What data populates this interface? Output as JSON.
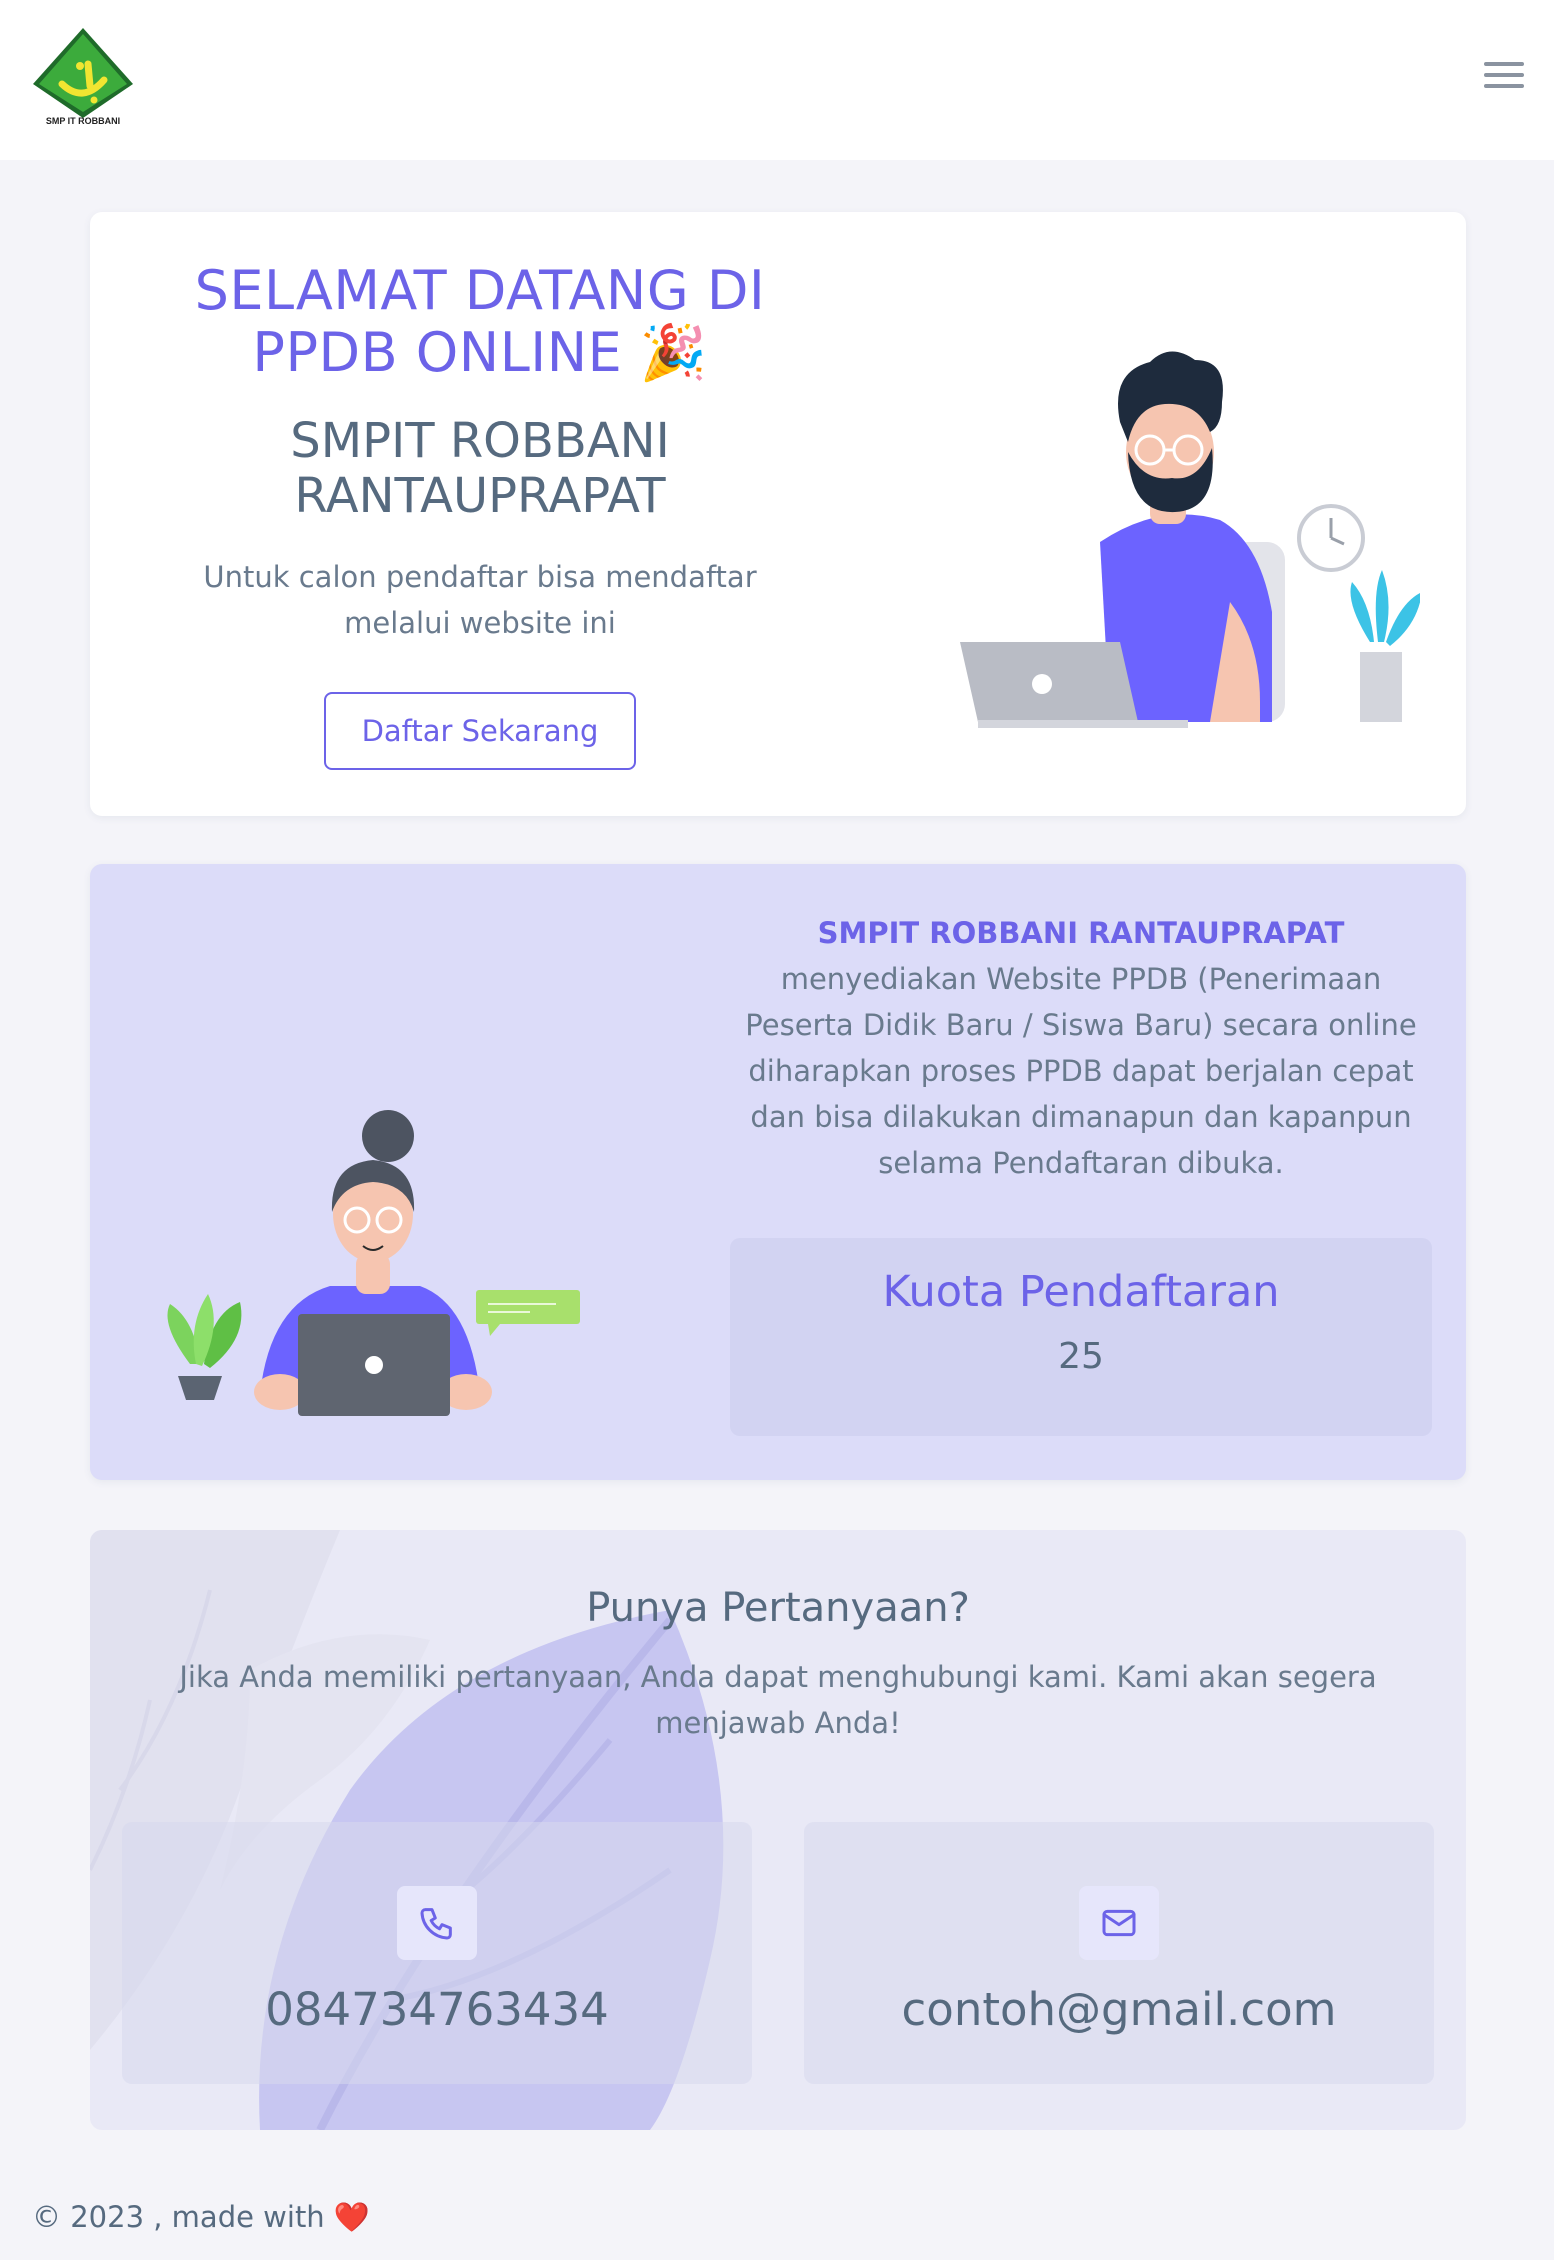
{
  "navbar": {
    "logo_text": "SMP IT ROBBANI",
    "menu_icon": "hamburger-menu-icon"
  },
  "hero": {
    "title": "SELAMAT DATANG DI PPDB ONLINE 🎉",
    "school": "SMPIT ROBBANI RANTAUPRAPAT",
    "description": "Untuk calon pendaftar bisa mendaftar melalui website ini",
    "button_label": "Daftar Sekarang"
  },
  "info": {
    "school_highlight": "SMPIT ROBBANI RANTAUPRAPAT",
    "text": " menyediakan Website PPDB (Penerimaan Peserta Didik Baru / Siswa Baru) secara online diharapkan proses PPDB dapat berjalan cepat dan bisa dilakukan dimanapun dan kapanpun selama Pendaftaran dibuka.",
    "quota_title": "Kuota Pendaftaran",
    "quota_value": "25"
  },
  "contact": {
    "title": "Punya Pertanyaan?",
    "description": "Jika Anda memiliki pertanyaan, Anda dapat menghubungi kami. Kami akan segera menjawab Anda!",
    "phone": "084734763434",
    "phone_icon": "phone-icon",
    "email": "contoh@gmail.com",
    "email_icon": "mail-icon"
  },
  "footer": {
    "text": "© 2023 , made with",
    "heart": "❤️"
  },
  "colors": {
    "primary": "#6c63e8",
    "text": "#566a7f",
    "background": "#f4f4f9",
    "info_background": "#dcdcf9"
  }
}
